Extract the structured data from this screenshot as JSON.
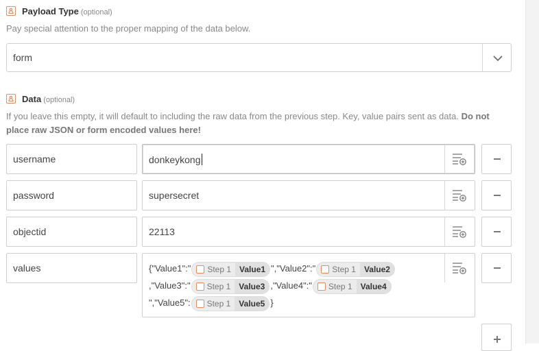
{
  "payload_type": {
    "title": "Payload Type",
    "optional": "(optional)",
    "help": "Pay special attention to the proper mapping of the data below.",
    "value": "form"
  },
  "data_field": {
    "title": "Data",
    "optional": "(optional)",
    "help_normal": "If you leave this empty, it will default to including the raw data from the previous step. Key, value pairs sent as data.",
    "help_bold": "Do not place raw JSON or form encoded values here!",
    "rows": [
      {
        "key": "username",
        "value": "donkeykong"
      },
      {
        "key": "password",
        "value": "supersecret"
      },
      {
        "key": "objectid",
        "value": "22113"
      },
      {
        "key": "values"
      }
    ],
    "template": {
      "t1": "{\"Value1\":\"",
      "pill1": {
        "step": "Step 1",
        "value": "Value1"
      },
      "t2": "\",\"Value2\":\"",
      "pill2": {
        "step": "Step 1",
        "value": "Value2"
      },
      "t3": ",\"Value3\":\"",
      "pill3": {
        "step": "Step 1",
        "value": "Value3"
      },
      "t4": ",\"Value4\":\"",
      "pill4": {
        "step": "Step 1",
        "value": "Value4"
      },
      "t5": "\",\"Value5\":",
      "pill5": {
        "step": "Step 1",
        "value": "Value5"
      },
      "t6": "}"
    }
  },
  "colors": {
    "accent_icon": "#f08a5a",
    "border": "#cfcfcf"
  },
  "icons": [
    "zapier-app-icon",
    "chevron-down-icon",
    "insert-field-icon",
    "minus-icon",
    "plus-icon"
  ]
}
